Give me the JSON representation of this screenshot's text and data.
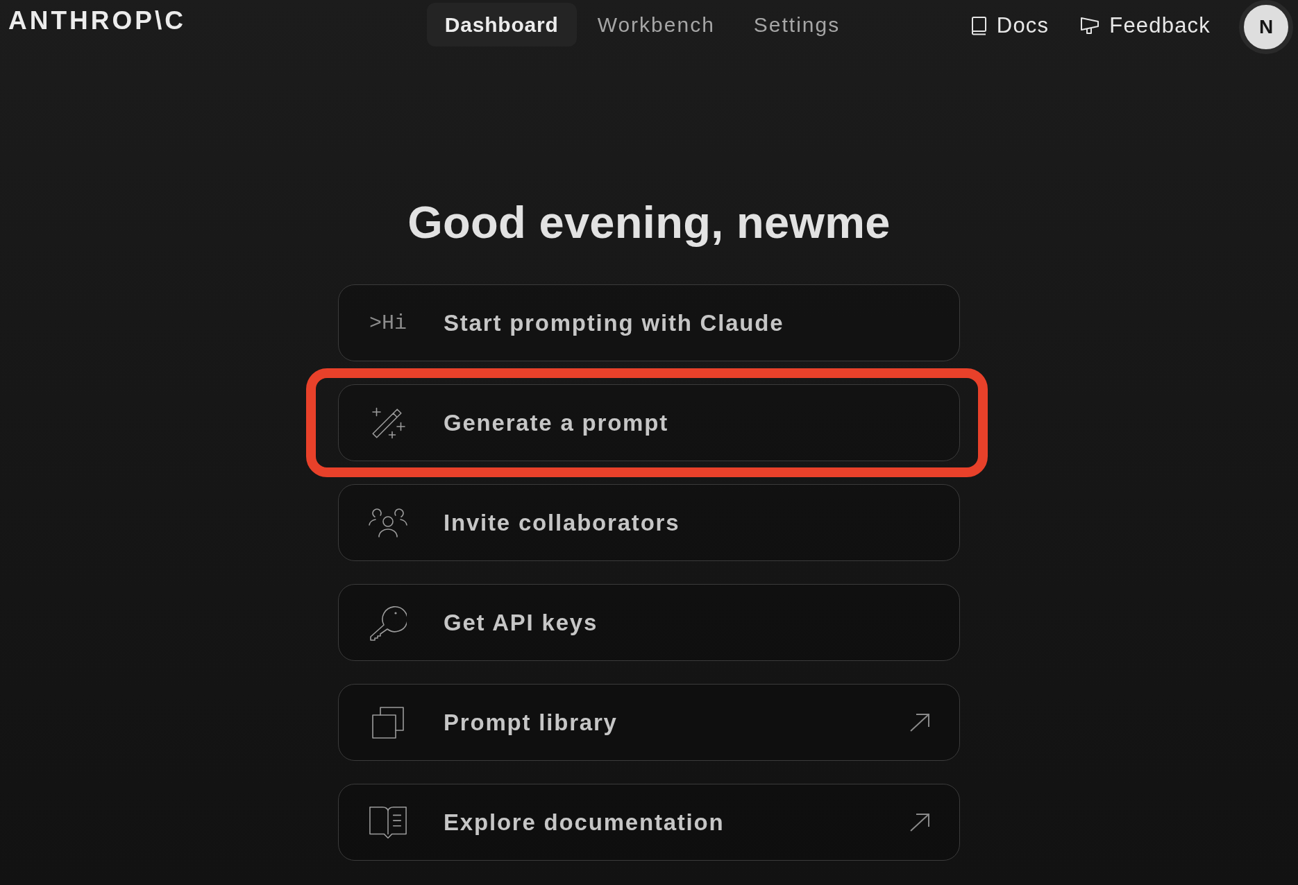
{
  "header": {
    "logo": "ANTHROP\\C",
    "tabs": [
      {
        "label": "Dashboard",
        "selected": true
      },
      {
        "label": "Workbench",
        "selected": false
      },
      {
        "label": "Settings",
        "selected": false
      }
    ],
    "links": [
      {
        "label": "Docs"
      },
      {
        "label": "Feedback"
      }
    ],
    "avatar": "N"
  },
  "greeting": "Good evening, newme",
  "cards": [
    {
      "glyph": ">Hi",
      "label": "Start prompting with Claude",
      "highlighted": false,
      "external": false
    },
    {
      "label": "Generate a prompt",
      "highlighted": true,
      "external": false
    },
    {
      "label": "Invite collaborators",
      "highlighted": false,
      "external": false
    },
    {
      "label": "Get API keys",
      "highlighted": false,
      "external": false
    },
    {
      "label": "Prompt library",
      "highlighted": false,
      "external": true
    },
    {
      "label": "Explore documentation",
      "highlighted": false,
      "external": true
    }
  ]
}
